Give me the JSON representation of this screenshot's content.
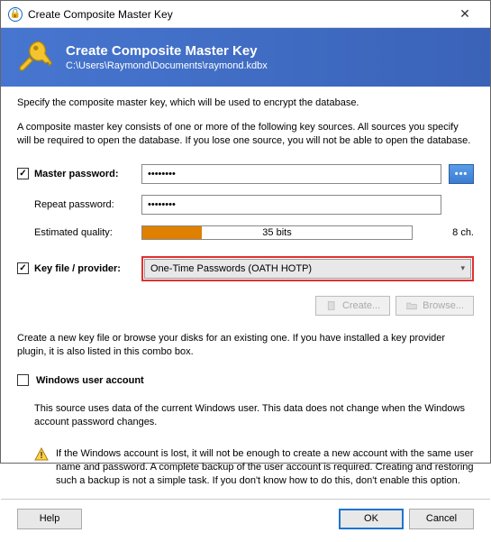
{
  "window": {
    "title": "Create Composite Master Key"
  },
  "header": {
    "title": "Create Composite Master Key",
    "path": "C:\\Users\\Raymond\\Documents\\raymond.kdbx"
  },
  "intro": "Specify the composite master key, which will be used to encrypt the database.",
  "desc": "A composite master key consists of one or more of the following key sources. All sources you specify will be required to open the database.  If you lose one source, you will not be able to open the database.",
  "master_pw": {
    "label": "Master password:",
    "value": "••••••••",
    "repeat_label": "Repeat password:",
    "repeat_value": "••••••••",
    "quality_label": "Estimated quality:",
    "quality_text": "35 bits",
    "chars": "8 ch."
  },
  "key_file": {
    "label": "Key file / provider:",
    "selected": "One-Time Passwords (OATH HOTP)",
    "create": "Create...",
    "browse": "Browse...",
    "help": "Create a new key file or browse your disks for an existing one. If you have installed a key provider plugin, it is also listed in this combo box."
  },
  "win_account": {
    "label": "Windows user account",
    "desc": "This source uses data of the current Windows user. This data does not change when the Windows account password changes.",
    "warn": "If the Windows account is lost, it will not be enough to create a new account with the same user name and password. A complete backup of the user account is required. Creating and restoring such a backup is not a simple task. If you don't know how to do this, don't enable this option."
  },
  "buttons": {
    "help": "Help",
    "ok": "OK",
    "cancel": "Cancel"
  }
}
